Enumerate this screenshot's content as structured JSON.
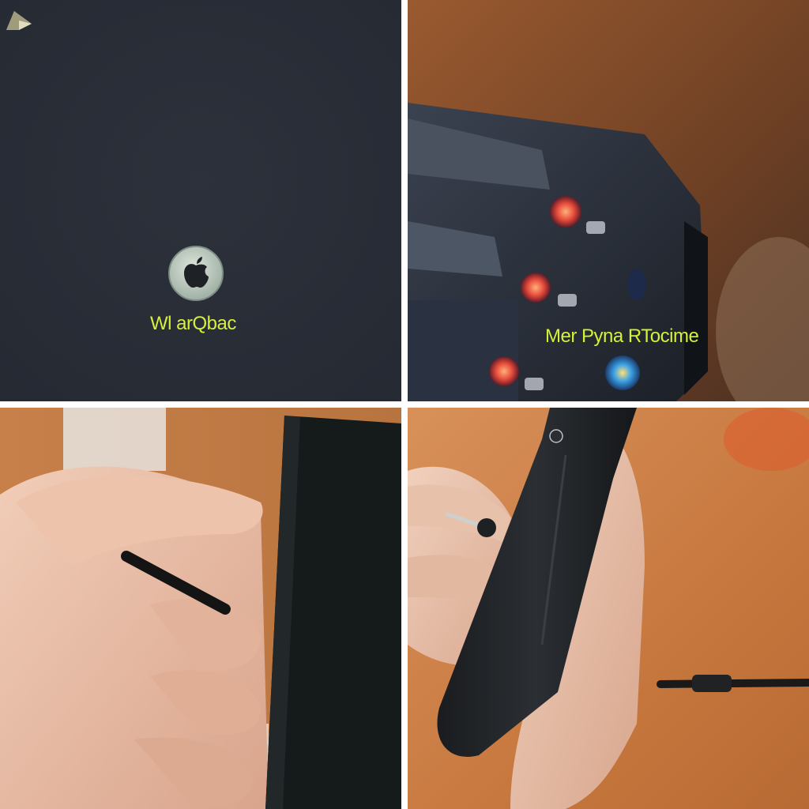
{
  "panels": [
    {
      "caption": "Wl arQbac",
      "icons": [
        "apple-logo-icon",
        "leaf-mark-icon"
      ],
      "background": "#2a2e37"
    },
    {
      "caption": "Mer Pyna RTocime",
      "icons": [],
      "background": "#7a4a2a"
    },
    {
      "caption": "",
      "icons": [],
      "background": "#c98a4e"
    },
    {
      "caption": "",
      "icons": [],
      "background": "#d4874a"
    }
  ],
  "colors": {
    "caption": "#d6f03a",
    "divider": "#ffffff"
  }
}
